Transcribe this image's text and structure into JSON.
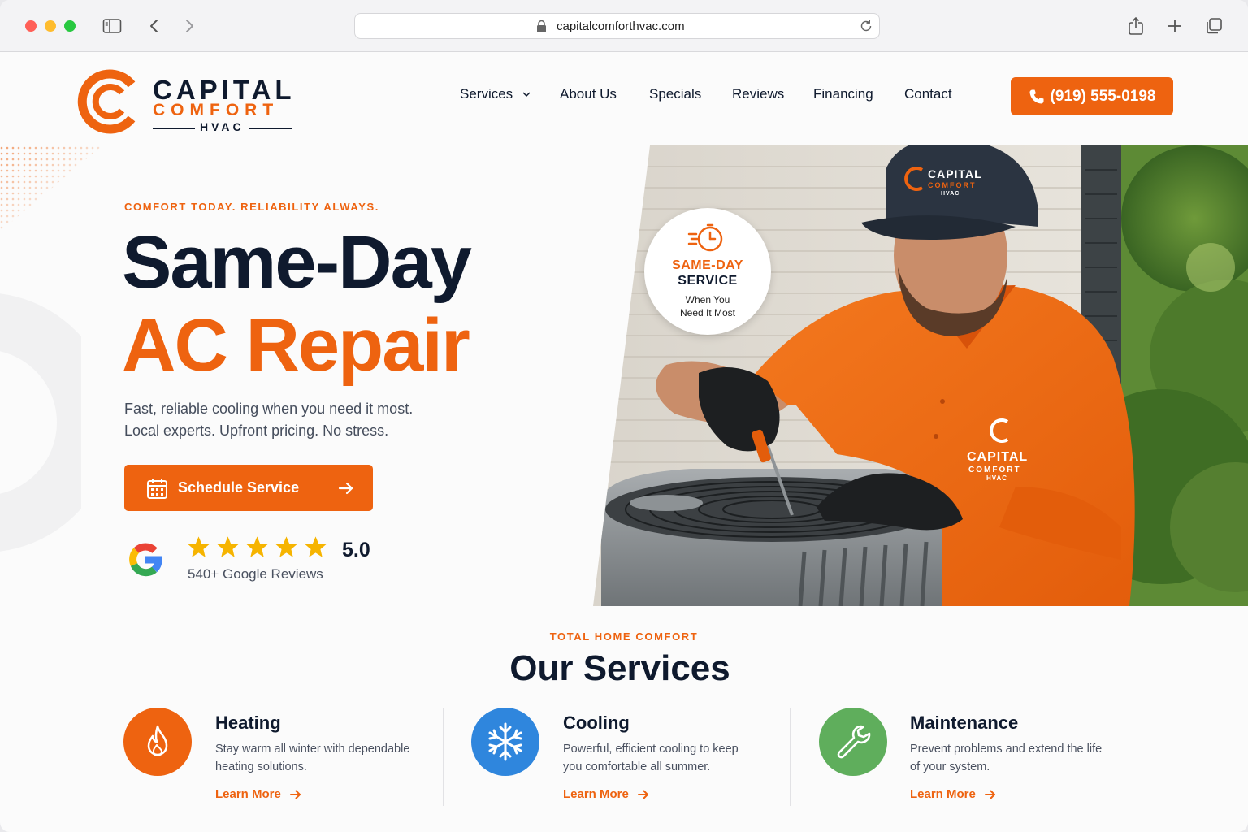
{
  "browser": {
    "url": "capitalcomforthvac.com"
  },
  "logo": {
    "capital": "CAPITAL",
    "comfort": "COMFORT",
    "hvac": "HVAC"
  },
  "nav": {
    "items": [
      "Services",
      "About Us",
      "Specials",
      "Reviews",
      "Financing",
      "Contact"
    ],
    "phone": "(919) 555-0198"
  },
  "hero": {
    "eyebrow": "COMFORT TODAY. RELIABILITY ALWAYS.",
    "title_line1": "Same-Day",
    "title_line2": "AC Repair",
    "subtitle_line1": "Fast, reliable cooling when you need it most.",
    "subtitle_line2": "Local experts. Upfront pricing. No stress.",
    "cta_label": "Schedule Service",
    "rating": "5.0",
    "stars": 5,
    "review_count": "540+ Google Reviews"
  },
  "photo": {
    "cap_logo_capital": "CAPITAL",
    "cap_logo_comfort": "COMFORT",
    "cap_logo_hvac": "HVAC",
    "shirt_logo_capital": "CAPITAL",
    "shirt_logo_comfort": "COMFORT",
    "shirt_logo_hvac": "HVAC"
  },
  "badge": {
    "line1": "SAME-DAY",
    "line2": "SERVICE",
    "line3": "When You",
    "line4": "Need It Most"
  },
  "services": {
    "eyebrow": "TOTAL HOME COMFORT",
    "title": "Our Services",
    "items": [
      {
        "name": "Heating",
        "desc": "Stay warm all winter with dependable heating solutions.",
        "link": "Learn More",
        "icon": "flame-icon",
        "color": "#ee6310"
      },
      {
        "name": "Cooling",
        "desc": "Powerful, efficient cooling to keep you comfortable all summer.",
        "link": "Learn More",
        "icon": "snowflake-icon",
        "color": "#2f86dd"
      },
      {
        "name": "Maintenance",
        "desc": "Prevent problems and extend the life of your system.",
        "link": "Learn More",
        "icon": "wrench-icon",
        "color": "#5fae5c"
      }
    ]
  },
  "colors": {
    "brand_orange": "#ee6310",
    "navy": "#0f1a2e",
    "star_gold": "#f6b400"
  }
}
